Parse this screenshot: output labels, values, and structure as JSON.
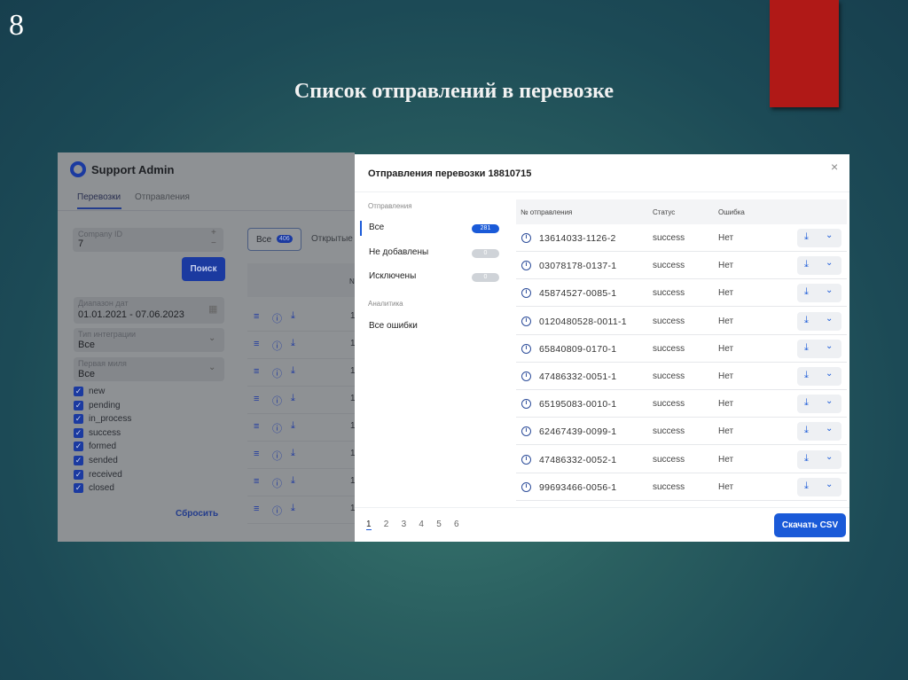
{
  "slide": {
    "number": "8",
    "title": "Список отправлений в перевозке",
    "accent_color": "#b01917"
  },
  "app": {
    "brand": "Support Admin",
    "tabs": [
      {
        "label": "Перевозки",
        "active": true
      },
      {
        "label": "Отправления",
        "active": false
      }
    ],
    "filters": {
      "company_id": {
        "label": "Company ID",
        "value": "7"
      },
      "search_button": "Поиск",
      "date_range": {
        "label": "Диапазон дат",
        "value": "01.01.2021 - 07.06.2023"
      },
      "integration_type": {
        "label": "Тип интеграции",
        "value": "Все"
      },
      "first_mile": {
        "label": "Первая миля",
        "value": "Все"
      },
      "statuses": [
        {
          "label": "new",
          "checked": true
        },
        {
          "label": "pending",
          "checked": true
        },
        {
          "label": "in_process",
          "checked": true
        },
        {
          "label": "success",
          "checked": true
        },
        {
          "label": "formed",
          "checked": true
        },
        {
          "label": "sended",
          "checked": true
        },
        {
          "label": "received",
          "checked": true
        },
        {
          "label": "closed",
          "checked": true
        }
      ],
      "reset": "Сбросить"
    },
    "segments": [
      {
        "label": "Все",
        "count": "406"
      },
      {
        "label": "Открытые"
      }
    ],
    "table_header_partial": "N",
    "row_first_digits": [
      "1",
      "1",
      "1",
      "1",
      "1",
      "1",
      "1",
      "1"
    ]
  },
  "modal": {
    "title": "Отправления перевозки 18810715",
    "close_icon": "close-icon",
    "nav": {
      "section1": "Отправления",
      "items": [
        {
          "label": "Все",
          "count": "281",
          "active": true
        },
        {
          "label": "Не добавлены",
          "count": "0"
        },
        {
          "label": "Исключены",
          "count": "0"
        }
      ],
      "section2": "Аналитика",
      "analytics_items": [
        {
          "label": "Все ошибки"
        }
      ]
    },
    "table": {
      "columns": [
        "№ отправления",
        "Статус",
        "Ошибка"
      ],
      "rows": [
        {
          "number": "13614033-1126-2",
          "status": "success",
          "error": "Нет"
        },
        {
          "number": "03078178-0137-1",
          "status": "success",
          "error": "Нет"
        },
        {
          "number": "45874527-0085-1",
          "status": "success",
          "error": "Нет"
        },
        {
          "number": "0120480528-0011-1",
          "status": "success",
          "error": "Нет"
        },
        {
          "number": "65840809-0170-1",
          "status": "success",
          "error": "Нет"
        },
        {
          "number": "47486332-0051-1",
          "status": "success",
          "error": "Нет"
        },
        {
          "number": "65195083-0010-1",
          "status": "success",
          "error": "Нет"
        },
        {
          "number": "62467439-0099-1",
          "status": "success",
          "error": "Нет"
        },
        {
          "number": "47486332-0052-1",
          "status": "success",
          "error": "Нет"
        },
        {
          "number": "99693466-0056-1",
          "status": "success",
          "error": "Нет"
        }
      ]
    },
    "pagination": {
      "pages": [
        "1",
        "2",
        "3",
        "4",
        "5",
        "6"
      ],
      "current": "1"
    },
    "download_csv": "Скачать CSV",
    "colors": {
      "primary": "#1a5ad8",
      "muted_badge": "#cfd3d8"
    }
  }
}
